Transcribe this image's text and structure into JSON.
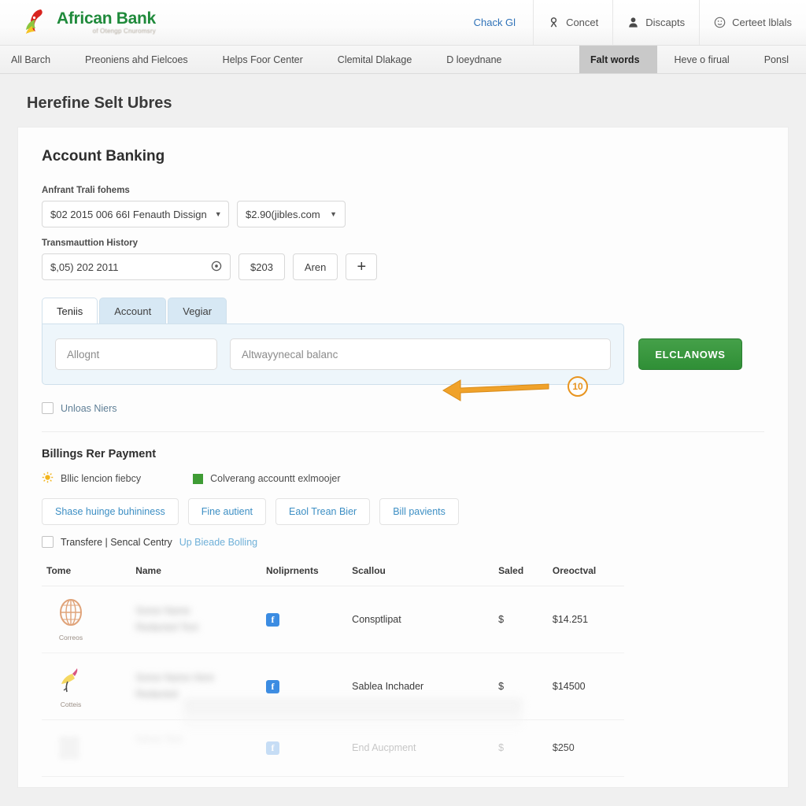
{
  "header": {
    "logo": {
      "name": "African Bank",
      "tagline": "of Otengp Cnuromsry",
      "icon": "african-bank-bird-logo"
    },
    "links": [
      {
        "label": "Chack Gl",
        "icon": "none",
        "style": "plain"
      },
      {
        "label": "Concet",
        "icon": "person-badge-icon",
        "style": "bordered"
      },
      {
        "label": "Discapts",
        "icon": "user-icon",
        "style": "bordered"
      },
      {
        "label": "Certeet lblals",
        "icon": "clock-face-icon",
        "style": "bordered"
      }
    ]
  },
  "subnav": {
    "left_items": [
      {
        "label": "All Barch"
      },
      {
        "label": "Preoniens ahd Fielcoes"
      },
      {
        "label": "Helps Foor Center"
      },
      {
        "label": "Clemital Dlakage"
      },
      {
        "label": "D loeydnane"
      }
    ],
    "right_items": [
      {
        "label": "Falt words",
        "active": true
      },
      {
        "label": "Heve o firual",
        "active": false
      },
      {
        "label": "Ponsl",
        "active": false
      }
    ]
  },
  "page": {
    "title": "Herefine Selt Ubres"
  },
  "card": {
    "title": "Account Banking",
    "account_section": {
      "label": "Anfrant Trali fohems",
      "account_select": {
        "value": "$02 2015 006 66I Fenauth Dissign",
        "caret": "chevron-down-icon"
      },
      "domain_select": {
        "value": "$2.90(jibles.com",
        "caret": "chevron-down-icon"
      }
    },
    "history_section": {
      "label": "Transmauttion History",
      "date_input": {
        "value": "$,05) 202 2011",
        "icon": "clock-icon"
      },
      "amount_button": "$203",
      "area_button": "Aren",
      "add_button": "+"
    },
    "tabs": [
      {
        "label": "Teniis",
        "active": true
      },
      {
        "label": "Account",
        "active": false
      },
      {
        "label": "Vegiar",
        "active": false
      }
    ],
    "tab_panel": {
      "input_left_placeholder": "Allognt",
      "input_right_placeholder": "Altwayynecal balanc"
    },
    "submit_button": "ELCLANOWS",
    "annotation": {
      "badge": "10",
      "arrow": "left-pointing-arrow"
    },
    "unload_checkbox": {
      "label": "Unloas Niers",
      "checked": false
    },
    "billing": {
      "title": "Billings Rer Payment",
      "legend": [
        {
          "label": "Bllic lencion fiebcy",
          "icon": "sun-icon",
          "color": "#f2b51e"
        },
        {
          "label": "Colverang accountt exlmoojer",
          "icon": "square-icon",
          "color": "#3f9c35"
        }
      ],
      "buttons": [
        "Shase huinge buhininess",
        "Fine autient",
        "Eaol Trean Bier",
        "Bill pavients"
      ],
      "transfer": {
        "checked": false,
        "text": "Transfere | Sencal Centry",
        "link": "Up Bieade Bolling"
      }
    },
    "table": {
      "columns": [
        "Tome",
        "Name",
        "Noliprnents",
        "Scallou",
        "Saled",
        "Oreoctval"
      ],
      "rows": [
        {
          "brand_icon": "globe-orb-icon",
          "brand_caption": "Correos",
          "name": "",
          "payment_icon": "facebook-icon",
          "scallou": "Consptlipat",
          "saled": "$",
          "oreoctval": "$14.251",
          "faded": false
        },
        {
          "brand_icon": "bird-feather-icon",
          "brand_caption": "Cotteis",
          "name": "",
          "payment_icon": "facebook-icon",
          "scallou": "Sablea Inchader",
          "saled": "$",
          "oreoctval": "$14500",
          "faded": false
        },
        {
          "brand_icon": "blurred-icon",
          "brand_caption": "",
          "name": "",
          "payment_icon": "facebook-icon",
          "scallou": "End Aucpment",
          "saled": "$",
          "oreoctval": "$250",
          "faded": true
        }
      ]
    }
  },
  "colors": {
    "brand_green": "#1f8a3b",
    "button_green": "#3f9c35",
    "link_blue": "#3d8fc4",
    "annotation_orange": "#e8941f",
    "facebook_blue": "#3b8ce2"
  }
}
